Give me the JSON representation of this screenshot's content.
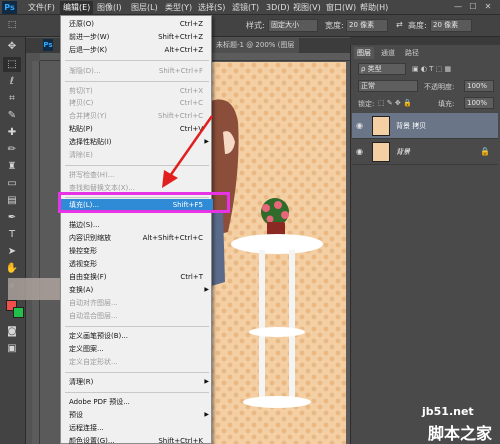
{
  "menubar": {
    "logo": "Ps",
    "items": [
      "文件(F)",
      "编辑(E)",
      "图像(I)",
      "图层(L)",
      "类型(Y)",
      "选择(S)",
      "滤镜(T)",
      "3D(D)",
      "视图(V)",
      "窗口(W)",
      "帮助(H)"
    ],
    "window_buttons": [
      "—",
      "☐",
      "✕"
    ]
  },
  "options": {
    "style_label": "样式:",
    "style_value": "固定大小",
    "width_label": "宽度:",
    "width_value": "20 像素",
    "height_label": "高度:",
    "height_value": "20 像素"
  },
  "document": {
    "tab_title": "未标题-1 @ 200% (图层",
    "tab_logo": "Ps"
  },
  "edit_menu": {
    "items": [
      {
        "label": "还原(O)",
        "shortcut": "Ctrl+Z",
        "disabled": false
      },
      {
        "label": "前进一步(W)",
        "shortcut": "Shift+Ctrl+Z",
        "disabled": false
      },
      {
        "label": "后退一步(K)",
        "shortcut": "Alt+Ctrl+Z",
        "disabled": false
      },
      {
        "label": "渐隐(D)...",
        "shortcut": "Shift+Ctrl+F",
        "disabled": true
      },
      {
        "label": "剪切(T)",
        "shortcut": "Ctrl+X",
        "disabled": true
      },
      {
        "label": "拷贝(C)",
        "shortcut": "Ctrl+C",
        "disabled": true
      },
      {
        "label": "合并拷贝(Y)",
        "shortcut": "Shift+Ctrl+C",
        "disabled": true
      },
      {
        "label": "粘贴(P)",
        "shortcut": "Ctrl+V",
        "disabled": false
      },
      {
        "label": "选择性粘贴(I)",
        "shortcut": "",
        "disabled": false,
        "submenu": true
      },
      {
        "label": "清除(E)",
        "shortcut": "",
        "disabled": true
      },
      {
        "label": "拼写检查(H)...",
        "shortcut": "",
        "disabled": true
      },
      {
        "label": "查找和替换文本(X)...",
        "shortcut": "",
        "disabled": true
      },
      {
        "label": "填充(L)...",
        "shortcut": "Shift+F5",
        "disabled": false,
        "highlighted": true
      },
      {
        "label": "描边(S)...",
        "shortcut": "",
        "disabled": false
      },
      {
        "label": "内容识别缩放",
        "shortcut": "Alt+Shift+Ctrl+C",
        "disabled": false
      },
      {
        "label": "操控变形",
        "shortcut": "",
        "disabled": false
      },
      {
        "label": "透视变形",
        "shortcut": "",
        "disabled": false
      },
      {
        "label": "自由变换(F)",
        "shortcut": "Ctrl+T",
        "disabled": false
      },
      {
        "label": "变换(A)",
        "shortcut": "",
        "disabled": false,
        "submenu": true
      },
      {
        "label": "自动对齐图层...",
        "shortcut": "",
        "disabled": true
      },
      {
        "label": "自动混合图层...",
        "shortcut": "",
        "disabled": true
      },
      {
        "label": "定义画笔预设(B)...",
        "shortcut": "",
        "disabled": false
      },
      {
        "label": "定义图案...",
        "shortcut": "",
        "disabled": false
      },
      {
        "label": "定义自定形状...",
        "shortcut": "",
        "disabled": true
      },
      {
        "label": "清理(R)",
        "shortcut": "",
        "disabled": false,
        "submenu": true
      },
      {
        "label": "Adobe PDF 预设...",
        "shortcut": "",
        "disabled": false
      },
      {
        "label": "预设",
        "shortcut": "",
        "disabled": false,
        "submenu": true
      },
      {
        "label": "远程连接...",
        "shortcut": "",
        "disabled": false
      },
      {
        "label": "颜色设置(G)...",
        "shortcut": "Shift+Ctrl+K",
        "disabled": false
      }
    ]
  },
  "layers_panel": {
    "tabs": [
      "图层",
      "通道",
      "路径"
    ],
    "kind_label": "ρ 类型",
    "blend_mode": "正常",
    "opacity_label": "不透明度:",
    "opacity_value": "100%",
    "lock_label": "锁定:",
    "fill_label": "填充:",
    "fill_value": "100%",
    "layers": [
      {
        "name": "背景 拷贝",
        "selected": true
      },
      {
        "name": "背景",
        "selected": false,
        "locked": true
      }
    ]
  },
  "watermark": {
    "url": "jb51.net",
    "text": "脚本之家"
  }
}
